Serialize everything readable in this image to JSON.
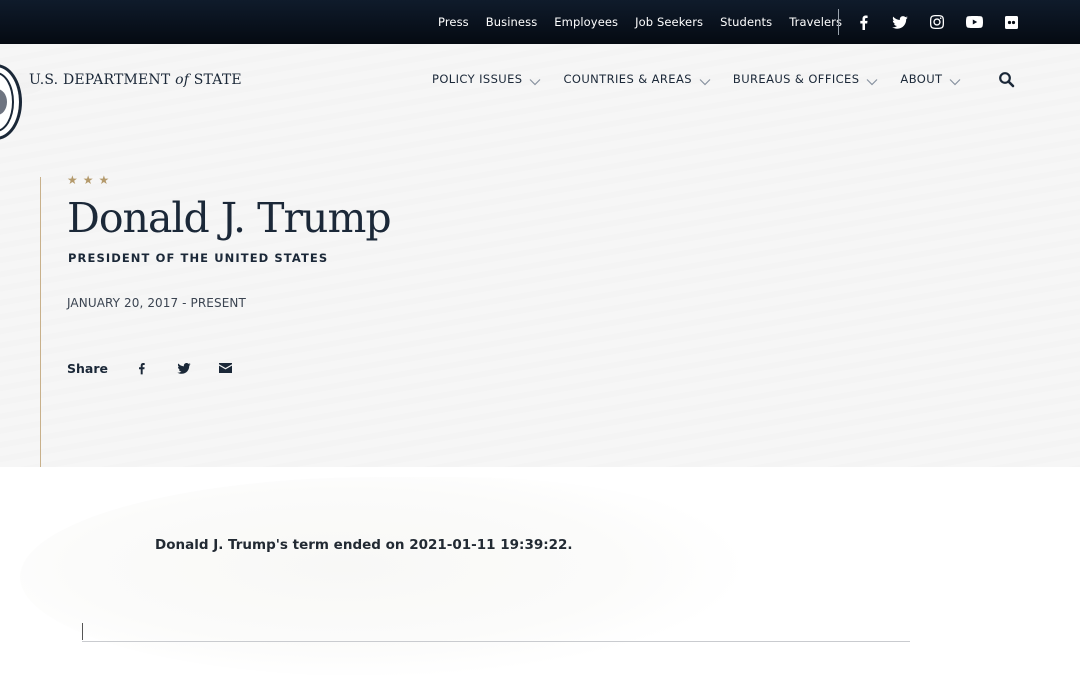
{
  "topbar": {
    "links": [
      "Press",
      "Business",
      "Employees",
      "Job Seekers",
      "Students",
      "Travelers"
    ],
    "social": [
      "facebook-icon",
      "twitter-icon",
      "instagram-icon",
      "youtube-icon",
      "flickr-icon"
    ]
  },
  "brand": {
    "prefix": "U.S. DEPARTMENT ",
    "of": "of",
    "suffix": " STATE"
  },
  "nav": {
    "items": [
      "POLICY ISSUES",
      "COUNTRIES & AREAS",
      "BUREAUS & OFFICES",
      "ABOUT"
    ],
    "search_icon": "search-icon"
  },
  "hero": {
    "stars": [
      "★",
      "★",
      "★"
    ],
    "title": "Donald J. Trump",
    "subtitle": "PRESIDENT OF THE UNITED STATES",
    "dates": "JANUARY 20, 2017 - PRESENT",
    "share_label": "Share",
    "share_icons": [
      "facebook-icon",
      "twitter-icon",
      "email-icon"
    ]
  },
  "content": {
    "message": "Donald J. Trump's term ended on 2021-01-11 19:39:22."
  },
  "colors": {
    "topbar": "#050a12",
    "navy": "#1b2838",
    "gold": "#b49a6c",
    "hero_bg": "#f6f6f6"
  }
}
